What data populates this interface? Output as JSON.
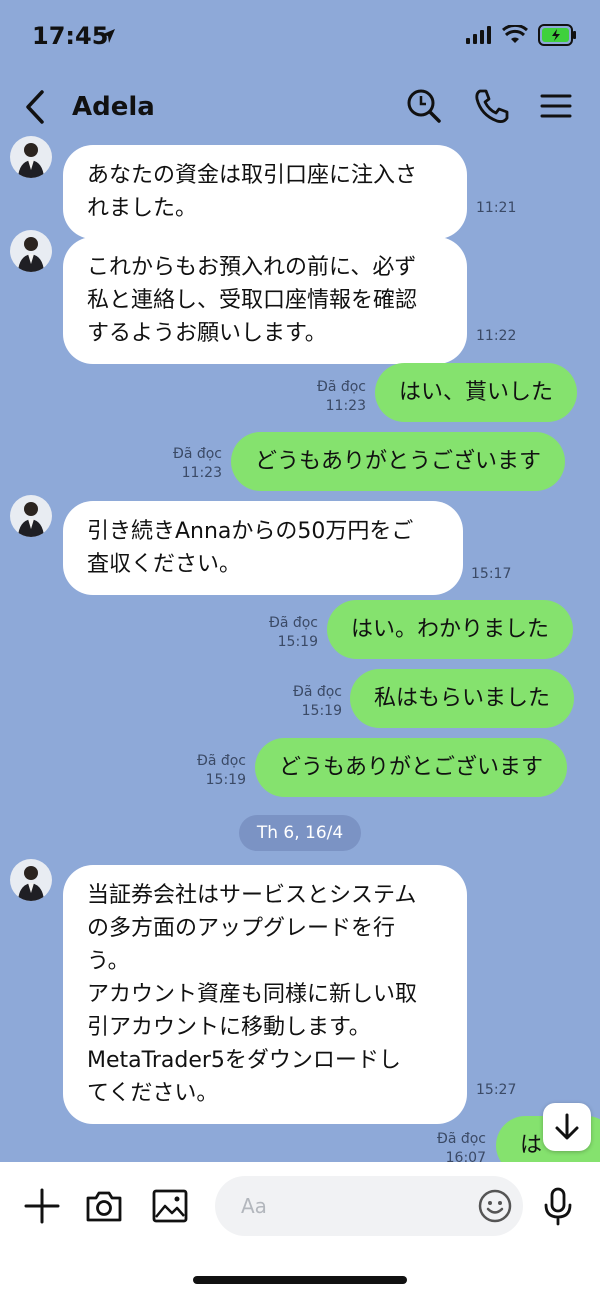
{
  "status": {
    "time": "17:45"
  },
  "header": {
    "title": "Adela"
  },
  "messages": [
    {
      "text": "あなたの資金は取引口座に注入さ\nれました。",
      "time": "11:21"
    },
    {
      "text": "これからもお預入れの前に、必ず\n私と連絡し、受取口座情報を確認\nするようお願いします。",
      "time": "11:22"
    },
    {
      "text": "はい、貰いした",
      "read": "Đã đọc",
      "time": "11:23"
    },
    {
      "text": "どうもありがとうございます",
      "read": "Đã đọc",
      "time": "11:23"
    },
    {
      "text": "引き続きAnnaからの50万円をご\n査収ください。",
      "time": "15:17"
    },
    {
      "text": "はい。わかりました",
      "read": "Đã đọc",
      "time": "15:19"
    },
    {
      "text": "私はもらいました",
      "read": "Đã đọc",
      "time": "15:19"
    },
    {
      "text": "どうもありがとございます",
      "read": "Đã đọc",
      "time": "15:19"
    },
    {
      "text": "当証券会社はサービスとシステム\nの多方面のアップグレードを行\nう。\nアカウント資産も同様に新しい取\n引アカウントに移動します。\nMetaTrader5をダウンロードし\nてください。",
      "time": "15:27"
    },
    {
      "text": "は",
      "read": "Đã đọc",
      "time": "16:07"
    }
  ],
  "date_divider": "Th 6, 16/4",
  "input": {
    "placeholder": "Aa"
  },
  "colors": {
    "background": "#8ea9d8",
    "outgoing": "#85e26e",
    "incoming": "#ffffff"
  },
  "icons": [
    "back-icon",
    "search-icon",
    "phone-icon",
    "menu-icon",
    "plus-icon",
    "camera-icon",
    "image-icon",
    "emoji-icon",
    "mic-icon",
    "arrow-down-icon"
  ]
}
